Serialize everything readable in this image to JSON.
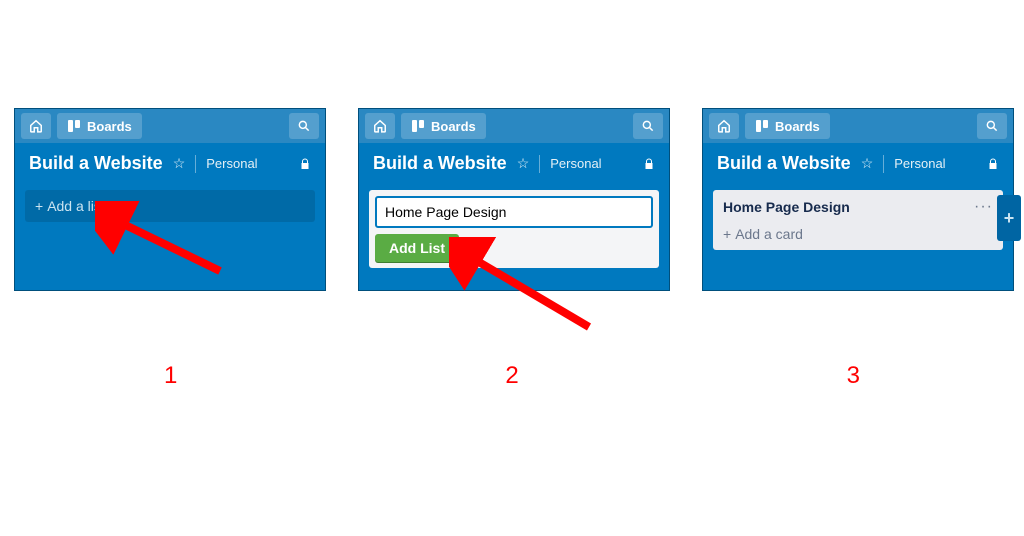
{
  "shared": {
    "boards_label": "Boards",
    "board_title": "Build a Website",
    "visibility_label": "Personal"
  },
  "panel1": {
    "add_list_label": "Add a list",
    "step": "1"
  },
  "panel2": {
    "list_name_value": "Home Page Design",
    "add_list_button": "Add List",
    "step": "2"
  },
  "panel3": {
    "list_title": "Home Page Design",
    "add_card_label": "Add a card",
    "step": "3"
  }
}
